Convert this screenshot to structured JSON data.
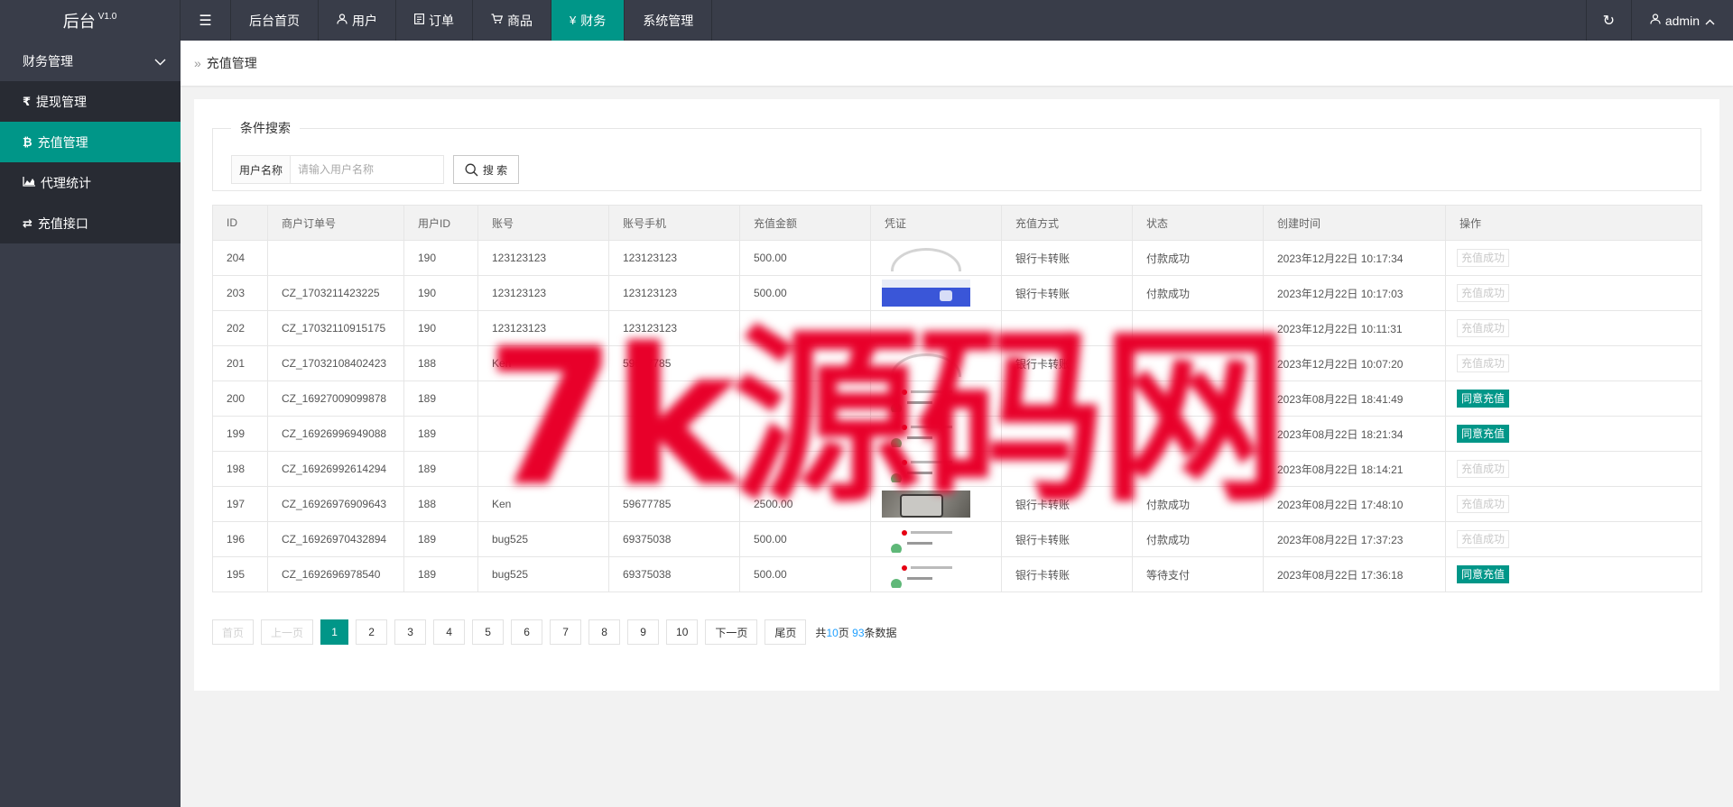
{
  "app": {
    "logo": "后台",
    "version": "V1.0"
  },
  "topnav": {
    "items": [
      {
        "label": "后台首页",
        "icon": ""
      },
      {
        "label": "用户",
        "icon": "user-icon"
      },
      {
        "label": "订单",
        "icon": "document-icon"
      },
      {
        "label": "商品",
        "icon": "cart-icon"
      },
      {
        "label": "财务",
        "icon": "yen-icon",
        "active": true
      },
      {
        "label": "系统管理",
        "icon": ""
      }
    ],
    "user": "admin"
  },
  "sidebar": {
    "group": "财务管理",
    "items": [
      {
        "label": "提现管理",
        "icon": "rupee-icon",
        "glyph": "₹"
      },
      {
        "label": "充值管理",
        "icon": "bitcoin-icon",
        "glyph": "₿",
        "active": true
      },
      {
        "label": "代理统计",
        "icon": "area-chart-icon",
        "glyph": ""
      },
      {
        "label": "充值接口",
        "icon": "exchange-icon",
        "glyph": "⇄"
      }
    ]
  },
  "breadcrumb": {
    "current": "充值管理"
  },
  "search": {
    "legend": "条件搜索",
    "label": "用户名称",
    "placeholder": "请输入用户名称",
    "value": "",
    "button": "搜 索"
  },
  "table": {
    "columns": [
      "ID",
      "商户订单号",
      "用户ID",
      "账号",
      "账号手机",
      "充值金额",
      "凭证",
      "充值方式",
      "状态",
      "创建时间",
      "操作"
    ],
    "rows": [
      {
        "id": "204",
        "order": "",
        "uid": "190",
        "account": "123123123",
        "phone": "123123123",
        "amount": "500.00",
        "voucher": "arc",
        "method": "银行卡转账",
        "status": "付款成功",
        "status_type": "green",
        "time": "2023年12月22日 10:17:34",
        "action": "充值成功",
        "action_type": "done"
      },
      {
        "id": "203",
        "order": "CZ_1703211423225",
        "uid": "190",
        "account": "123123123",
        "phone": "123123123",
        "amount": "500.00",
        "voucher": "blue",
        "method": "银行卡转账",
        "status": "付款成功",
        "status_type": "green",
        "time": "2023年12月22日 10:17:03",
        "action": "充值成功",
        "action_type": "done"
      },
      {
        "id": "202",
        "order": "CZ_17032110915175",
        "uid": "190",
        "account": "123123123",
        "phone": "123123123",
        "amount": "",
        "voucher": "",
        "method": "",
        "status": "",
        "status_type": "green",
        "time": "2023年12月22日 10:11:31",
        "action": "充值成功",
        "action_type": "done"
      },
      {
        "id": "201",
        "order": "CZ_17032108402423",
        "uid": "188",
        "account": "Ken",
        "phone": "59677785",
        "amount": "",
        "voucher": "arc",
        "method": "银行卡转账",
        "status": "",
        "status_type": "green",
        "time": "2023年12月22日 10:07:20",
        "action": "充值成功",
        "action_type": "done"
      },
      {
        "id": "200",
        "order": "CZ_16927009099878",
        "uid": "189",
        "account": "",
        "phone": "",
        "amount": "",
        "voucher": "rec",
        "method": "",
        "status": "",
        "status_type": "blue",
        "time": "2023年08月22日 18:41:49",
        "action": "同意充值",
        "action_type": "agree"
      },
      {
        "id": "199",
        "order": "CZ_16926996949088",
        "uid": "189",
        "account": "",
        "phone": "",
        "amount": "",
        "voucher": "rec",
        "method": "",
        "status": "",
        "status_type": "blue",
        "time": "2023年08月22日 18:21:34",
        "action": "同意充值",
        "action_type": "agree"
      },
      {
        "id": "198",
        "order": "CZ_16926992614294",
        "uid": "189",
        "account": "",
        "phone": "",
        "amount": "",
        "voucher": "rec",
        "method": "",
        "status": "",
        "status_type": "green",
        "time": "2023年08月22日 18:14:21",
        "action": "充值成功",
        "action_type": "done"
      },
      {
        "id": "197",
        "order": "CZ_16926976909643",
        "uid": "188",
        "account": "Ken",
        "phone": "59677785",
        "amount": "2500.00",
        "voucher": "photo",
        "method": "银行卡转账",
        "status": "付款成功",
        "status_type": "green",
        "time": "2023年08月22日 17:48:10",
        "action": "充值成功",
        "action_type": "done"
      },
      {
        "id": "196",
        "order": "CZ_16926970432894",
        "uid": "189",
        "account": "bug525",
        "phone": "69375038",
        "amount": "500.00",
        "voucher": "rec",
        "method": "银行卡转账",
        "status": "付款成功",
        "status_type": "green",
        "time": "2023年08月22日 17:37:23",
        "action": "充值成功",
        "action_type": "done"
      },
      {
        "id": "195",
        "order": "CZ_1692696978540",
        "uid": "189",
        "account": "bug525",
        "phone": "69375038",
        "amount": "500.00",
        "voucher": "rec",
        "method": "银行卡转账",
        "status": "等待支付",
        "status_type": "blue",
        "time": "2023年08月22日 17:36:18",
        "action": "同意充值",
        "action_type": "agree"
      }
    ]
  },
  "pager": {
    "first": "首页",
    "prev": "上一页",
    "pages": [
      "1",
      "2",
      "3",
      "4",
      "5",
      "6",
      "7",
      "8",
      "9",
      "10"
    ],
    "current": "1",
    "next": "下一页",
    "last": "尾页",
    "info_prefix": "共",
    "total_pages": "10",
    "info_mid": "页",
    "total_records": "93",
    "info_suffix": "条数据"
  },
  "watermark": "7k源码网",
  "colors": {
    "accent": "#009688",
    "topbar": "#393d49",
    "sidebar_sub": "#282b33",
    "success": "#5fb878",
    "pending": "#1e9fff"
  }
}
